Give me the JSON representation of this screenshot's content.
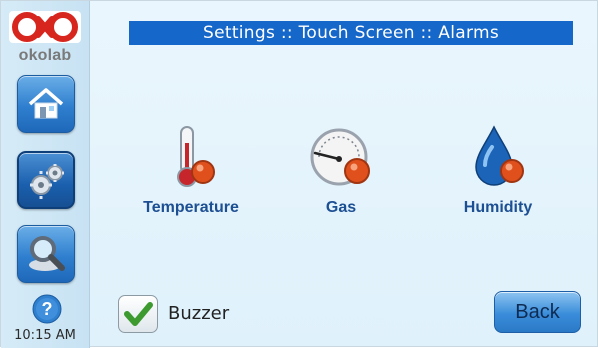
{
  "header": {
    "title": "Settings :: Touch Screen :: Alarms"
  },
  "sidebar": {
    "brand": "okolab",
    "nav": [
      {
        "name": "home",
        "icon": "home-icon"
      },
      {
        "name": "settings",
        "icon": "gears-icon",
        "active": true
      },
      {
        "name": "search",
        "icon": "magnifier-icon"
      }
    ],
    "help_icon": "help-icon",
    "time": "10:15 AM"
  },
  "alarms": [
    {
      "label": "Temperature",
      "icon": "thermometer-icon"
    },
    {
      "label": "Gas",
      "icon": "gauge-icon"
    },
    {
      "label": "Humidity",
      "icon": "water-drop-icon"
    }
  ],
  "buzzer": {
    "label": "Buzzer",
    "checked": true
  },
  "back_button": {
    "label": "Back"
  },
  "colors": {
    "title_bar": "#1567c9",
    "label_text": "#1d4f93",
    "alarm_dot": "#e0501d",
    "button_blue": "#2f7fcf"
  }
}
